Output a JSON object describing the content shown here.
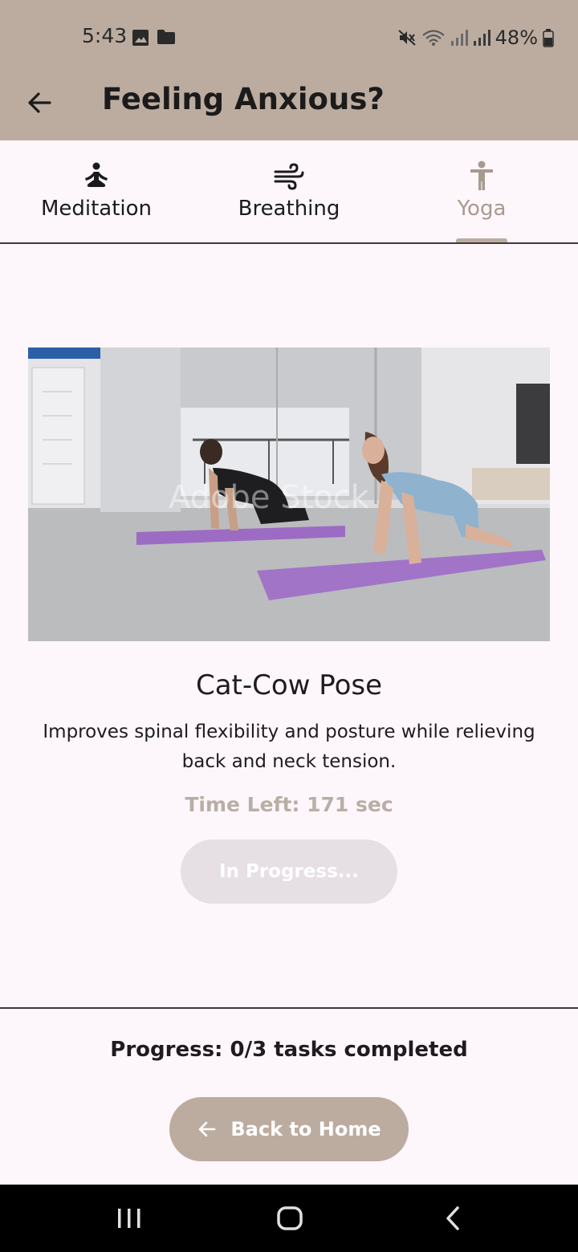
{
  "status_bar": {
    "time": "5:43",
    "battery": "48%",
    "left_icons": [
      "image-icon",
      "folder-icon"
    ],
    "right_icons": [
      "mute-icon",
      "wifi-icon",
      "signal-icon",
      "signal-icon",
      "battery-icon"
    ]
  },
  "app_bar": {
    "title": "Feeling Anxious?",
    "back_icon": "arrow-left-icon",
    "background": "#bcaca0"
  },
  "tabs": [
    {
      "label": "Meditation",
      "icon": "meditation-icon",
      "active": false
    },
    {
      "label": "Breathing",
      "icon": "wind-icon",
      "active": false
    },
    {
      "label": "Yoga",
      "icon": "accessibility-figure-icon",
      "active": true
    }
  ],
  "exercise": {
    "title": "Cat-Cow Pose",
    "description": "Improves spinal flexibility and posture while relieving back and neck tension.",
    "time_left": "Time Left: 171 sec",
    "status_button": "In Progress...",
    "image_watermark": "Adobe Stock"
  },
  "footer": {
    "progress": "Progress: 0/3 tasks completed",
    "home_button": "Back to Home"
  },
  "colors": {
    "accent": "#bcaca0",
    "background": "#fdf7fc",
    "disabled_button": "#e6e0e5",
    "muted_text": "#b9aea5"
  }
}
